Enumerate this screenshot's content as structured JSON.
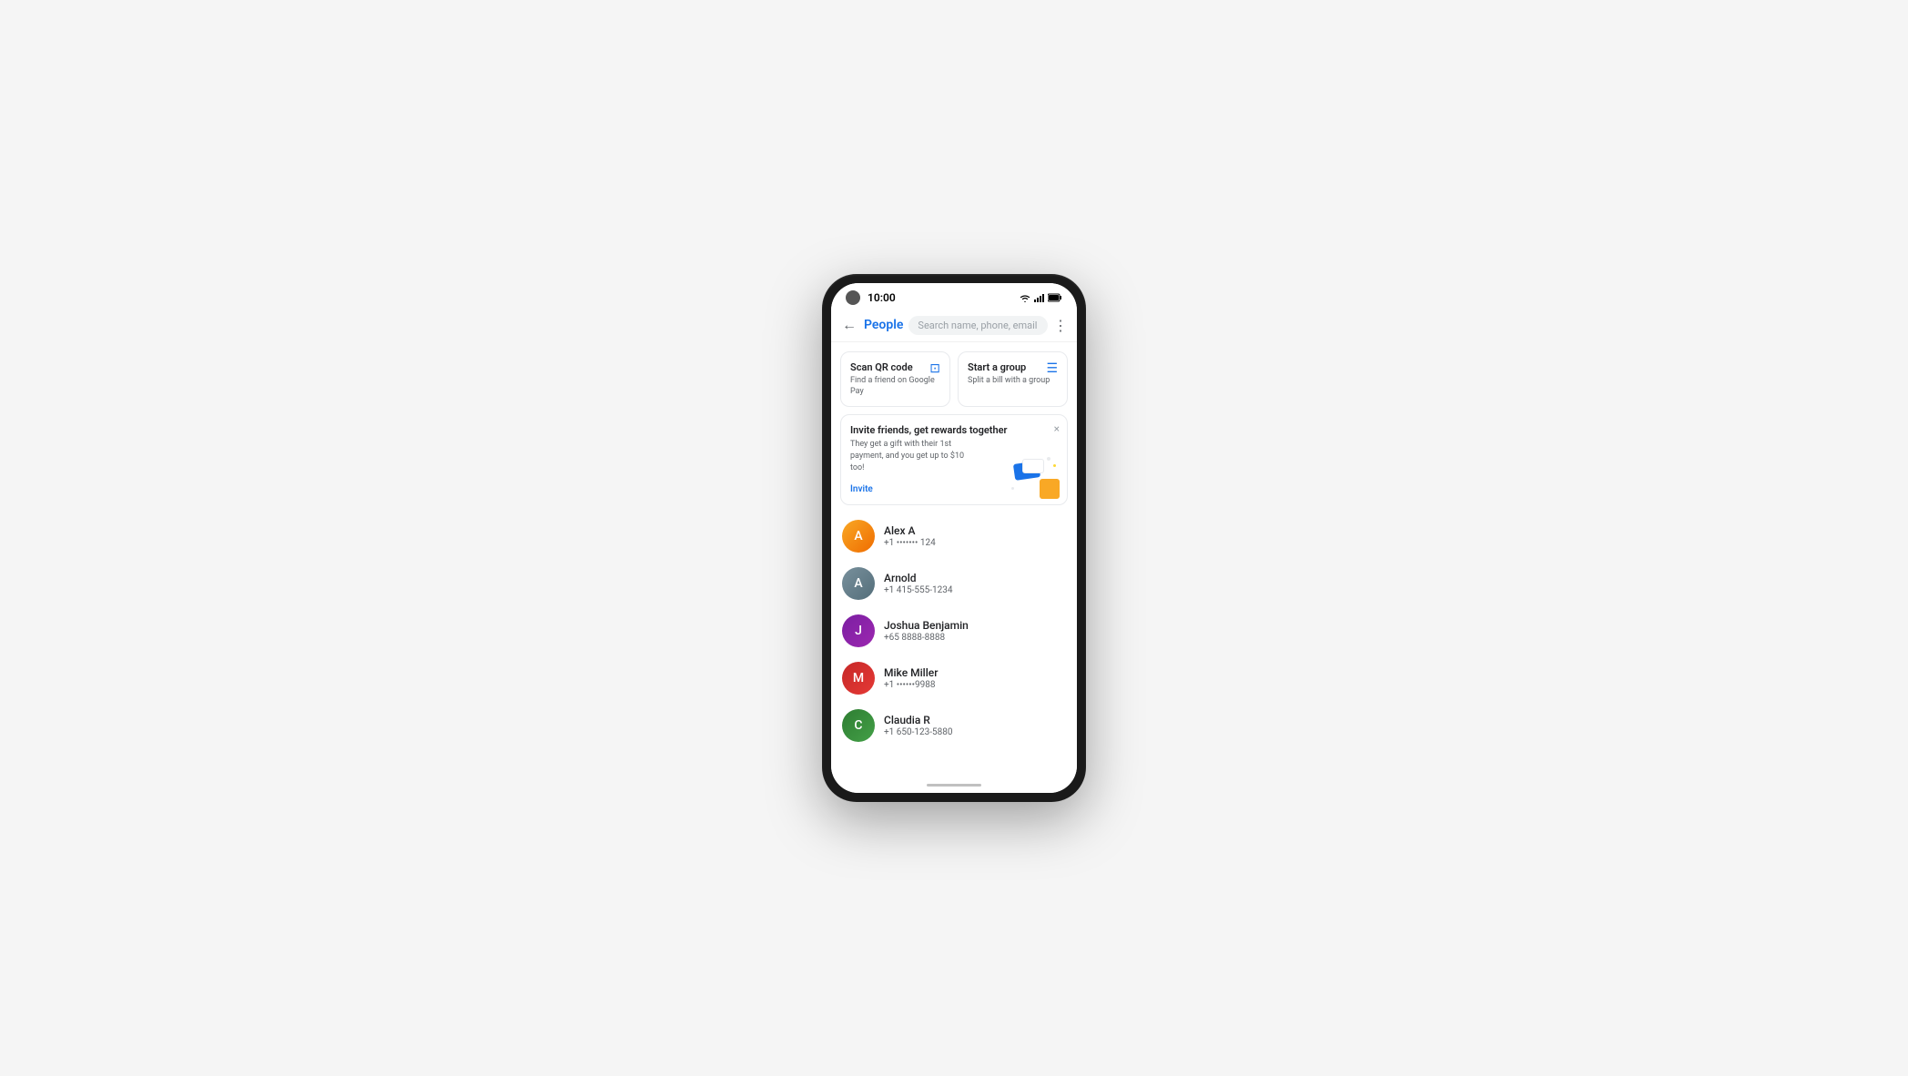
{
  "status_bar": {
    "time": "10:00",
    "avatar_color": "#555"
  },
  "nav": {
    "back_label": "←",
    "people_label": "People",
    "search_placeholder": "Search name, phone, email",
    "more_label": "⋮"
  },
  "action_cards": [
    {
      "id": "scan-qr",
      "title": "Scan QR code",
      "subtitle": "Find a friend on Google Pay",
      "icon": "⊡"
    },
    {
      "id": "start-group",
      "title": "Start a group",
      "subtitle": "Split a bill with a group",
      "icon": "☰"
    }
  ],
  "invite_banner": {
    "title": "Invite friends, get rewards together",
    "description": "They get a gift with their 1st payment, and you get up to $10 too!",
    "invite_label": "Invite",
    "close_label": "×"
  },
  "contacts": [
    {
      "id": "alex-a",
      "name": "Alex A",
      "phone": "+1 ••••••• 124",
      "avatar_initials": "A",
      "avatar_class": "av-alex"
    },
    {
      "id": "arnold",
      "name": "Arnold",
      "phone": "+1 415-555-1234",
      "avatar_initials": "A",
      "avatar_class": "av-arnold"
    },
    {
      "id": "joshua-benjamin",
      "name": "Joshua Benjamin",
      "phone": "+65 8888-8888",
      "avatar_initials": "J",
      "avatar_class": "av-joshua"
    },
    {
      "id": "mike-miller",
      "name": "Mike Miller",
      "phone": "+1 ••••••9988",
      "avatar_initials": "M",
      "avatar_class": "av-mike"
    },
    {
      "id": "claudia-r",
      "name": "Claudia R",
      "phone": "+1 650-123-5880",
      "avatar_initials": "C",
      "avatar_class": "av-claudia"
    }
  ]
}
